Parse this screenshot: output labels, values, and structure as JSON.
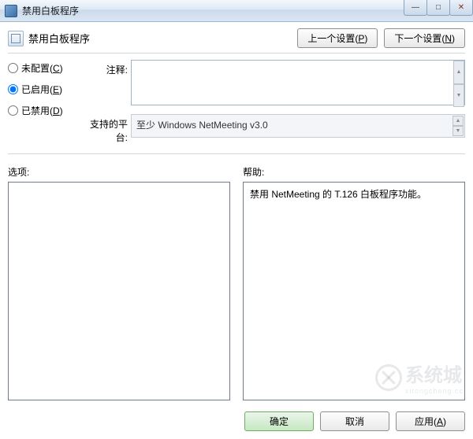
{
  "window": {
    "title": "禁用白板程序",
    "min": "—",
    "max": "□",
    "close": "✕"
  },
  "header": {
    "title": "禁用白板程序",
    "prev": "上一个设置(",
    "prev_key": "P",
    "prev_suffix": ")",
    "next": "下一个设置(",
    "next_key": "N",
    "next_suffix": ")"
  },
  "radios": {
    "not_configured": "未配置(",
    "not_configured_key": "C",
    "not_configured_suffix": ")",
    "enabled": "已启用(",
    "enabled_key": "E",
    "enabled_suffix": ")",
    "disabled": "已禁用(",
    "disabled_key": "D",
    "disabled_suffix": ")",
    "selected": "enabled"
  },
  "labels": {
    "comment": "注释:",
    "platform": "支持的平台:",
    "options": "选项:",
    "help": "帮助:"
  },
  "fields": {
    "comment_value": "",
    "platform_value": "至少 Windows NetMeeting v3.0"
  },
  "help": {
    "text": "禁用 NetMeeting 的 T.126 白板程序功能。"
  },
  "buttons": {
    "ok": "确定",
    "cancel": "取消",
    "apply": "应用(",
    "apply_key": "A",
    "apply_suffix": ")"
  },
  "watermark": {
    "text": "系统城",
    "sub": "xitongcheng.cc"
  }
}
